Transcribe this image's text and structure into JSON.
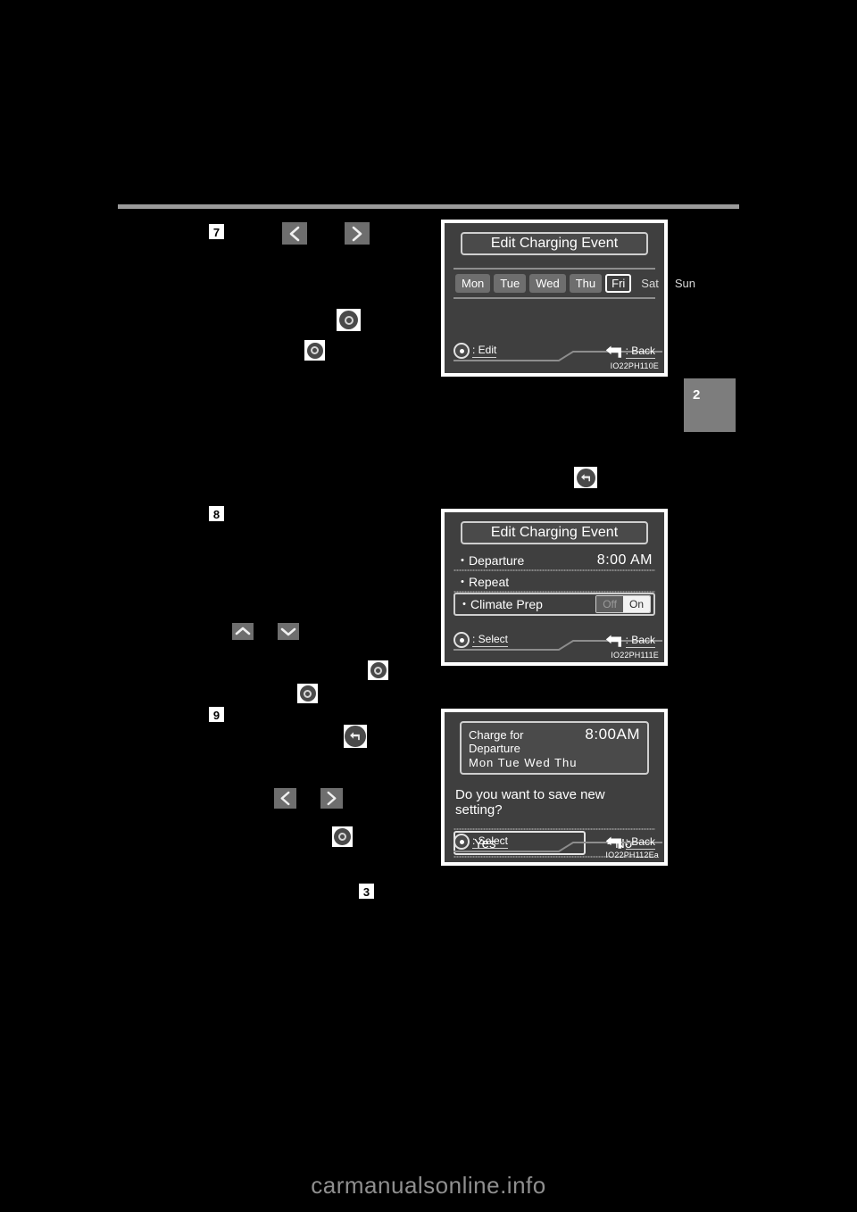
{
  "page": {
    "chapter_number": "2",
    "watermark": "carmanualsonline.info"
  },
  "steps": [
    {
      "number": "7"
    },
    {
      "number": "8"
    },
    {
      "number": "9"
    },
    {
      "number": "3"
    }
  ],
  "icons": {
    "left_chevron": "chevron-left-icon",
    "right_chevron": "chevron-right-icon",
    "up_chevron": "chevron-up-icon",
    "down_chevron": "chevron-down-icon",
    "enter_knob": "enter-knob-icon",
    "back_arrow": "back-arrow-icon"
  },
  "figures": [
    {
      "id": "edit-charging-event-days",
      "code": "IO22PH110E",
      "title": "Edit Charging Event",
      "days": [
        {
          "label": "Mon",
          "state": "selected"
        },
        {
          "label": "Tue",
          "state": "selected"
        },
        {
          "label": "Wed",
          "state": "selected"
        },
        {
          "label": "Thu",
          "state": "selected"
        },
        {
          "label": "Fri",
          "state": "cursor"
        },
        {
          "label": "Sat",
          "state": "normal"
        },
        {
          "label": "Sun",
          "state": "normal"
        }
      ],
      "hint_left": ": Edit",
      "hint_right": ": Back"
    },
    {
      "id": "edit-charging-event-list",
      "code": "IO22PH111E",
      "title": "Edit Charging Event",
      "rows": [
        {
          "label": "・Departure",
          "value": "8:00 AM",
          "type": "value"
        },
        {
          "label": "・Repeat",
          "value": "",
          "type": "value"
        },
        {
          "label": "・Climate Prep",
          "type": "toggle",
          "off_label": "Off",
          "on_label": "On",
          "state": "On"
        }
      ],
      "hint_left": ": Select",
      "hint_right": ": Back"
    },
    {
      "id": "save-new-setting-confirm",
      "code": "IO22PH112Ea",
      "header_label": "Charge for Departure",
      "header_time": "8:00AM",
      "header_days": "Mon  Tue  Wed  Thu",
      "question": "Do you want to save new setting?",
      "options": [
        {
          "label": "・Yes",
          "state": "cursor"
        },
        {
          "label": "・No",
          "state": "normal"
        }
      ],
      "hint_left": ": Select",
      "hint_right": ": Back"
    }
  ]
}
